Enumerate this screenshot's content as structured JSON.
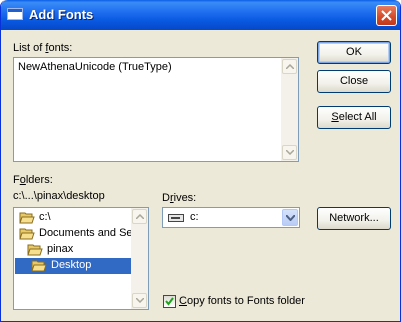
{
  "window": {
    "title": "Add Fonts"
  },
  "fonts": {
    "label_pre": "List of ",
    "label_u": "f",
    "label_post": "onts:",
    "items": [
      "NewAthenaUnicode (TrueType)"
    ]
  },
  "buttons": {
    "ok": "OK",
    "close": "Close",
    "select_all_u": "S",
    "select_all_post": "elect All",
    "network": "Network..."
  },
  "folders": {
    "label_pre": "F",
    "label_u": "o",
    "label_post": "lders:",
    "path": "c:\\...\\pinax\\desktop",
    "items": [
      {
        "label": "c:\\",
        "selected": false
      },
      {
        "label": "Documents and Se",
        "selected": false
      },
      {
        "label": "pinax",
        "selected": false
      },
      {
        "label": "Desktop",
        "selected": true
      }
    ]
  },
  "drives": {
    "label_pre": "D",
    "label_u": "r",
    "label_post": "ives:",
    "selected": "c:"
  },
  "copy_option": {
    "label_u": "C",
    "label_post": "opy fonts to Fonts folder",
    "checked": true
  }
}
